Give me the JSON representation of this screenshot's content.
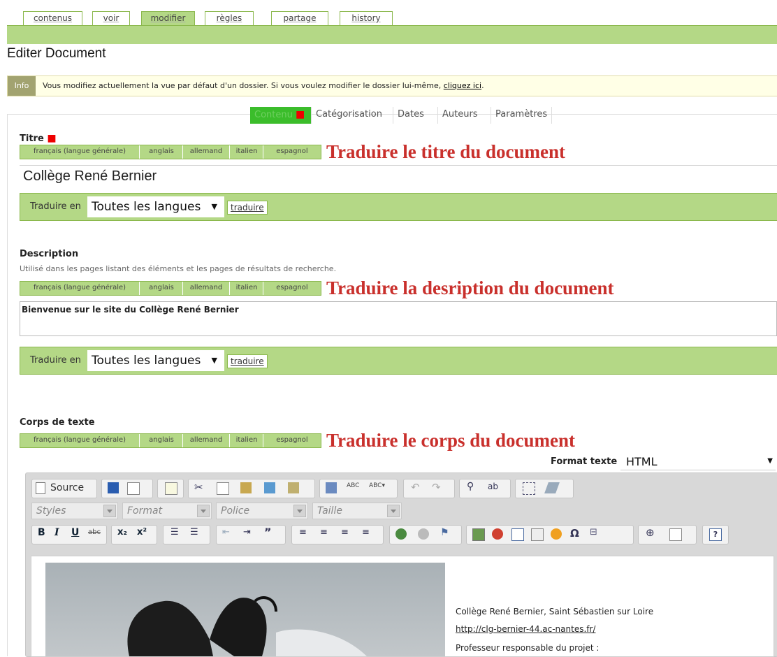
{
  "top_tabs": [
    {
      "label": "contenus"
    },
    {
      "label": "voir"
    },
    {
      "label": "modifier"
    },
    {
      "label": "règles"
    },
    {
      "label": "partage"
    },
    {
      "label": "history"
    }
  ],
  "page_title": "Editer Document",
  "info": {
    "label": "Info",
    "text": "Vous modifiez actuellement la vue par défaut d'un dossier. Si vous voulez modifier le dossier lui-même, ",
    "link": "cliquez ici",
    "suffix": "."
  },
  "content_tabs": [
    {
      "label": "Contenu"
    },
    {
      "label": "Catégorisation"
    },
    {
      "label": "Dates"
    },
    {
      "label": "Auteurs"
    },
    {
      "label": "Paramètres"
    }
  ],
  "languages": [
    "français (langue générale)",
    "anglais",
    "allemand",
    "italien",
    "espagnol"
  ],
  "titre": {
    "label": "Titre",
    "translate_heading": "Traduire le titre du document",
    "value": "Collège René Bernier"
  },
  "translate": {
    "label": "Traduire en",
    "select_value": "Toutes les langues",
    "button": "traduire"
  },
  "description": {
    "label": "Description",
    "help": "Utilisé dans les pages listant des éléments et les pages de résultats de recherche.",
    "translate_heading": "Traduire la desription du document",
    "value": "Bienvenue sur le site du Collège René Bernier"
  },
  "corps": {
    "label": "Corps de texte",
    "translate_heading": "Traduire le corps du document",
    "format_label": "Format texte",
    "format_value": "HTML"
  },
  "editor": {
    "source_label": "Source",
    "combos": [
      "Styles",
      "Format",
      "Police",
      "Taille"
    ],
    "content_lines": {
      "line1": "Collège René Bernier, Saint Sébastien sur Loire",
      "link": "http://clg-bernier-44.ac-nantes.fr/",
      "line3": "Professeur responsable du projet :"
    }
  },
  "colors": {
    "green_light": "#b4d886",
    "green_active": "#3bbd2b",
    "red_heading": "#c9302c"
  }
}
